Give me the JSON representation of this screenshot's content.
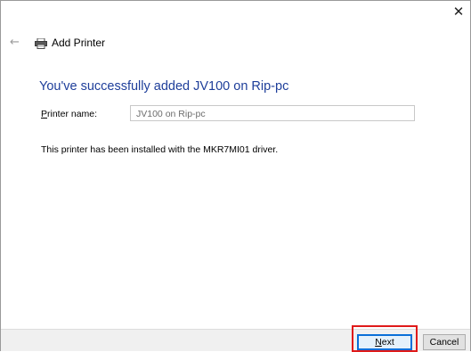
{
  "window": {
    "close_glyph": "✕",
    "back_glyph": "←"
  },
  "header": {
    "title": "Add Printer",
    "icon": "printer-icon"
  },
  "main": {
    "heading": "You've successfully added JV100 on Rip-pc",
    "printer_name_label_accel": "P",
    "printer_name_label_rest": "rinter name:",
    "printer_name_value": "JV100 on Rip-pc",
    "driver_note": "This printer has been installed with the MKR7MI01 driver."
  },
  "footer": {
    "next_label_accel": "N",
    "next_label_rest": "ext",
    "cancel_label": "Cancel"
  },
  "colors": {
    "heading": "#1e3e9a",
    "highlight": "#e01a1a",
    "default_button_border": "#0a6fd8"
  }
}
